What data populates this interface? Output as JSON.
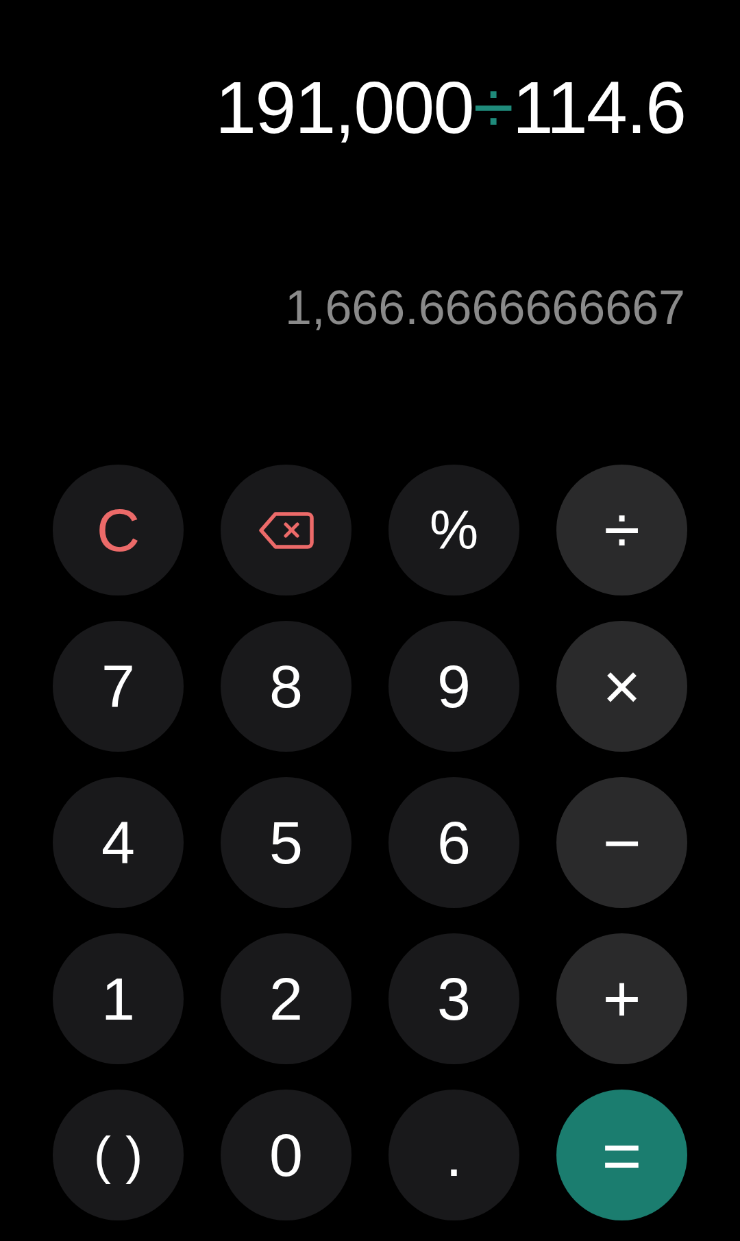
{
  "display": {
    "expression": [
      {
        "kind": "number",
        "text": "191,000"
      },
      {
        "kind": "operator",
        "text": "÷"
      },
      {
        "kind": "number",
        "text": "114.6"
      }
    ],
    "result": "1,666.6666666667"
  },
  "keypad": [
    {
      "kind": "clear",
      "label": "C"
    },
    {
      "kind": "backspace"
    },
    {
      "kind": "percent",
      "label": "%"
    },
    {
      "kind": "operator",
      "label": "÷"
    },
    {
      "kind": "digit",
      "label": "7"
    },
    {
      "kind": "digit",
      "label": "8"
    },
    {
      "kind": "digit",
      "label": "9"
    },
    {
      "kind": "operator",
      "label": "×"
    },
    {
      "kind": "digit",
      "label": "4"
    },
    {
      "kind": "digit",
      "label": "5"
    },
    {
      "kind": "digit",
      "label": "6"
    },
    {
      "kind": "operator",
      "label": "−"
    },
    {
      "kind": "digit",
      "label": "1"
    },
    {
      "kind": "digit",
      "label": "2"
    },
    {
      "kind": "digit",
      "label": "3"
    },
    {
      "kind": "operator",
      "label": "+"
    },
    {
      "kind": "parentheses",
      "label": "( )"
    },
    {
      "kind": "digit",
      "label": "0"
    },
    {
      "kind": "decimal",
      "label": "."
    },
    {
      "kind": "equals",
      "label": "="
    }
  ]
}
